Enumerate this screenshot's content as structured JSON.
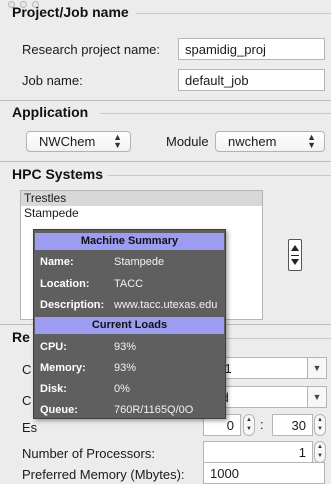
{
  "project": {
    "title": "Project/Job name",
    "research_label": "Research project name:",
    "research_value": "spamidig_proj",
    "job_label": "Job name:",
    "job_value": "default_job"
  },
  "application": {
    "title": "Application",
    "app_value": "NWChem",
    "module_label": "Module",
    "module_value": "nwchem"
  },
  "hpc": {
    "title": "HPC Systems",
    "systems": [
      "Trestles",
      "Stampede"
    ]
  },
  "tooltip": {
    "summary_header": "Machine Summary",
    "name_label": "Name:",
    "name_value": "Stampede",
    "location_label": "Location:",
    "location_value": "TACC",
    "description_label": "Description:",
    "description_value": "www.tacc.utexas.edu",
    "loads_header": "Current Loads",
    "cpu_label": "CPU:",
    "cpu_value": "93%",
    "memory_label": "Memory:",
    "memory_value": "93%",
    "disk_label": "Disk:",
    "disk_value": "0%",
    "queue_label": "Queue:",
    "queue_value": "760R/1165Q/0O"
  },
  "resources": {
    "title_fragment": "Re",
    "row1_label_fragment": "C",
    "row1_value_fragment": "151",
    "row2_label_fragment": "C",
    "row2_value_fragment": "red",
    "row3_label_fragment": "Es",
    "row3_hours_fragment": "0",
    "row3_colon": ":",
    "row3_minutes": "30",
    "processors_label": "Number of Processors:",
    "processors_value": "1",
    "memory_label": "Preferred Memory (Mbytes):",
    "memory_value": "1000"
  }
}
